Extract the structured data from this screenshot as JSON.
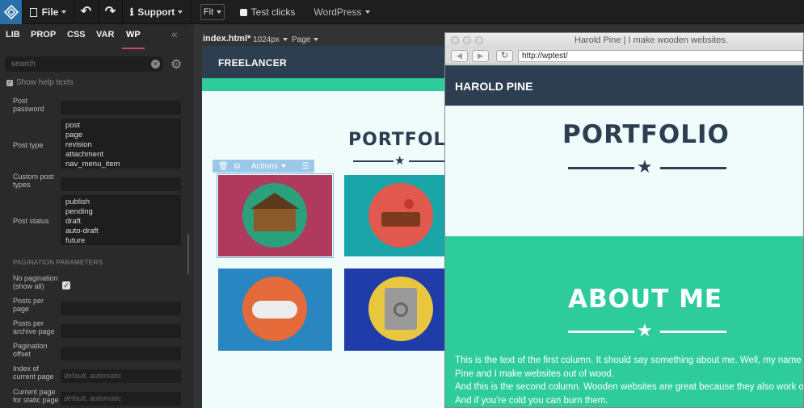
{
  "toolbar": {
    "file": "File",
    "support": "Support",
    "fit": "Fit",
    "test_clicks": "Test clicks",
    "wordpress": "WordPress"
  },
  "left_tabs": [
    "LIB",
    "PROP",
    "CSS",
    "VAR",
    "WP"
  ],
  "search": {
    "placeholder": "search"
  },
  "help_texts": "Show help texts",
  "params": {
    "post_password": "Post password",
    "post_type": "Post type",
    "post_type_options": [
      "post",
      "page",
      "revision",
      "attachment",
      "nav_menu_item"
    ],
    "custom_post_types": "Custom post types",
    "post_status": "Post status",
    "post_status_options": [
      "publish",
      "pending",
      "draft",
      "auto-draft",
      "future"
    ],
    "pagination_header": "PAGINATION PARAMETERS",
    "no_pagination": "No pagination (show all)",
    "posts_per_page": "Posts per page",
    "posts_per_archive": "Posts per archive page",
    "pagination_offset": "Pagination offset",
    "index_current_page": "Index of current page",
    "index_current_page_ph": "default, automatic",
    "current_page_static": "Current page for static page",
    "current_page_static_ph": "default, automatic"
  },
  "doc": {
    "file": "index.html*",
    "size": "1024px",
    "page": "Page"
  },
  "preview": {
    "brand": "FREELANCER",
    "portfolio": "PORTFOLIO",
    "actions": "Actions"
  },
  "browser": {
    "title": "Harold Pine | I make wooden websites.",
    "url": "http://wptest/",
    "brand": "HAROLD PINE",
    "portfolio": "PORTFOLIO",
    "about": "ABOUT ME",
    "about_lines": [
      "This is the text of the first column. It should say something about me. Well, my name is",
      "Pine and I make websites out of wood.",
      "And this is the second column. Wooden websites are great because they also work of",
      "And if you're cold you can burn them."
    ]
  },
  "colors": {
    "navy": "#2c3e50",
    "green": "#2ecc9a"
  }
}
